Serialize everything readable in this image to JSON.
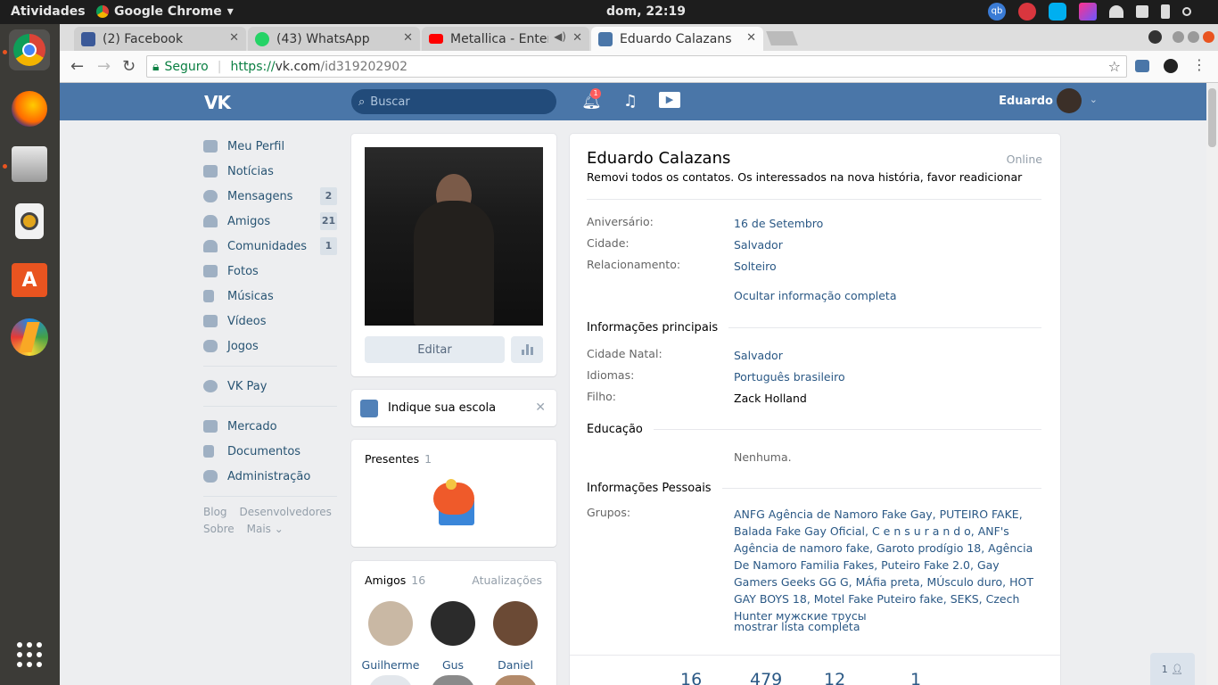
{
  "os": {
    "activities": "Atividades",
    "app_name": "Google Chrome",
    "clock": "dom, 22:19",
    "tray_badge": "qb"
  },
  "dock": [
    "chrome-icon",
    "firefox-icon",
    "files-icon",
    "rhythmbox-icon",
    "software-center-icon",
    "app-icon",
    "show-apps-icon"
  ],
  "browser": {
    "tabs": [
      {
        "label": "(2) Facebook",
        "color": "#3b5998"
      },
      {
        "label": "(43) WhatsApp",
        "color": "#25d366"
      },
      {
        "label": "Metallica - Enter",
        "color": "#ff0000"
      },
      {
        "label": "Eduardo Calazans",
        "color": "#4a76a8"
      }
    ],
    "security_label": "Seguro",
    "url_scheme": "https://",
    "url_host": "vk.com",
    "url_path": "/id319202902"
  },
  "vk": {
    "logo": "VK",
    "search_placeholder": "Buscar",
    "notif_count": "1",
    "user_name": "Eduardo",
    "nav": [
      {
        "label": "Meu Perfil",
        "count": ""
      },
      {
        "label": "Notícias",
        "count": ""
      },
      {
        "label": "Mensagens",
        "count": "2"
      },
      {
        "label": "Amigos",
        "count": "21"
      },
      {
        "label": "Comunidades",
        "count": "1"
      },
      {
        "label": "Fotos",
        "count": ""
      },
      {
        "label": "Músicas",
        "count": ""
      },
      {
        "label": "Vídeos",
        "count": ""
      },
      {
        "label": "Jogos",
        "count": ""
      }
    ],
    "nav2": [
      {
        "label": "VK Pay"
      }
    ],
    "nav3": [
      {
        "label": "Mercado"
      },
      {
        "label": "Documentos"
      },
      {
        "label": "Administração"
      }
    ],
    "footer": {
      "blog": "Blog",
      "dev": "Desenvolvedores",
      "about": "Sobre",
      "more": "Mais ⌄"
    },
    "edit_button": "Editar",
    "school_prompt": "Indique sua escola",
    "gifts": {
      "title": "Presentes",
      "count": "1"
    },
    "friends": {
      "title": "Amigos",
      "count": "16",
      "updates": "Atualizações",
      "list": [
        {
          "name": "Guilherme",
          "color": "#c9b8a4"
        },
        {
          "name": "Gus",
          "color": "#2b2b2b"
        },
        {
          "name": "Daniel",
          "color": "#6b4a35"
        }
      ]
    }
  },
  "profile": {
    "name": "Eduardo Calazans",
    "online": "Online",
    "status": "Removi todos os contatos. Os interessados na nova história, favor readicionar",
    "birthday_label": "Aniversário:",
    "birthday": "16 de Setembro",
    "city_label": "Cidade:",
    "city": "Salvador",
    "relationship_label": "Relacionamento:",
    "relationship": "Solteiro",
    "hide_info": "Ocultar informação completa",
    "main_info_title": "Informações principais",
    "hometown_label": "Cidade Natal:",
    "hometown": "Salvador",
    "languages_label": "Idiomas:",
    "languages": "Português brasileiro",
    "child_label": "Filho:",
    "child": "Zack Holland",
    "education_title": "Educação",
    "education": "Nenhuma.",
    "personal_title": "Informações Pessoais",
    "groups_label": "Grupos:",
    "groups": "ANFG Agência de Namoro Fake Gay, PUTEIRO FAKE, Balada Fake Gay Oficial, C e n s u r a n d o, ANF's Agência de namoro fake, Garoto prodígio 18, Agência De Namoro Familia Fakes, Puteiro Fake 2.0, Gay Gamers Geeks GG G, MÁfia preta, MÚsculo duro, HOT GAY BOYS 18, Motel Fake Puteiro fake, SEKS, Czech Hunter мужские трусы",
    "show_full_list": "mostrar lista completa",
    "counters": [
      "16",
      "479",
      "12",
      "1"
    ]
  },
  "chat_counter": "1"
}
